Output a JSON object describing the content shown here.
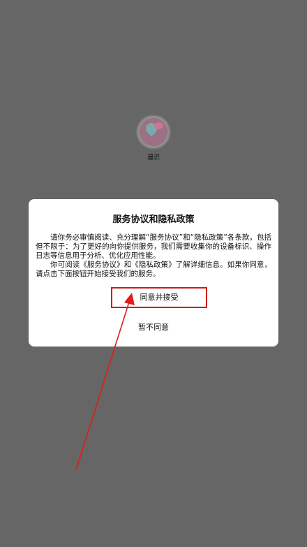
{
  "app": {
    "name": "遇识",
    "logo_icon": "app-logo-icon"
  },
  "dialog": {
    "title": "服务协议和隐私政策",
    "paragraph_1": "请你务必审慎阅读、充分理解“服务协议”和“隐私政策”各条款，包括但不限于：为了更好的向你提供服务，我们需要收集你的设备标识、操作日志等信息用于分析、优化应用性能。",
    "paragraph_2": "你可阅读《服务协议》和《隐私政策》了解详细信息。如果你同意，请点击下面按钮开始接受我们的服务。",
    "agree_label": "同意并接受",
    "decline_label": "暂不同意"
  },
  "colors": {
    "background": "#666666",
    "dialog": "#ffffff",
    "highlight": "#d31616"
  }
}
